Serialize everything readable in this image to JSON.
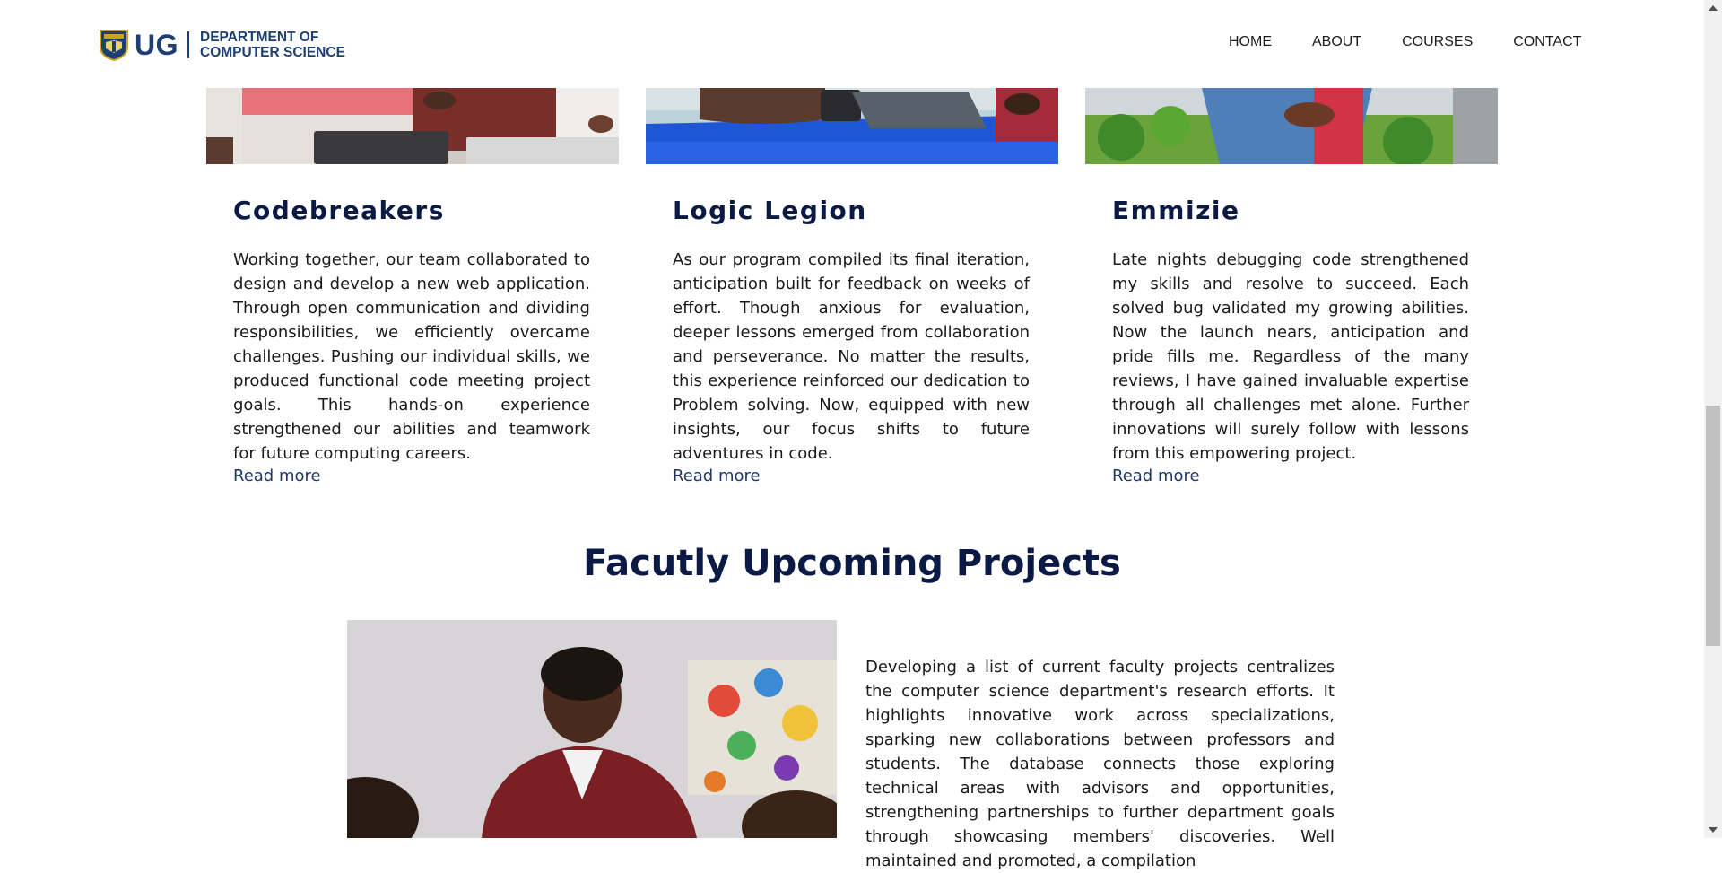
{
  "header": {
    "logo_ug": "UG",
    "logo_line1": "DEPARTMENT OF",
    "logo_line2": "COMPUTER SCIENCE",
    "nav": [
      "HOME",
      "ABOUT",
      "COURSES",
      "CONTACT"
    ]
  },
  "cards": [
    {
      "title": "Codebreakers",
      "text": "Working together, our team collaborated to design and develop a new web application. Through open communication and dividing responsibilities, we efficiently overcame challenges. Pushing our individual skills, we produced functional code meeting project goals. This hands-on experience strengthened our abilities and teamwork for future computing careers.",
      "link": "Read more"
    },
    {
      "title": "Logic Legion",
      "text": "As our program compiled its final iteration, anticipation built for feedback on weeks of effort. Though anxious for evaluation, deeper lessons emerged from collaboration and perseverance. No matter the results, this experience reinforced our dedication to Problem solving. Now, equipped with new insights, our focus shifts to future adventures in code.",
      "link": "Read more"
    },
    {
      "title": "Emmizie",
      "text": "Late nights debugging code strengthened my skills and resolve to succeed. Each solved bug validated my growing abilities. Now the launch nears, anticipation and pride fills me. Regardless of the many reviews, I have gained invaluable expertise through all challenges met alone. Further innovations will surely follow with lessons from this empowering project.",
      "link": "Read more"
    }
  ],
  "faculty": {
    "title": "Facutly Upcoming Projects",
    "text": "Developing a list of current faculty projects centralizes the computer science department's research efforts. It highlights innovative work across specializations, sparking new collaborations between professors and students. The database connects those exploring technical areas with advisors and opportunities, strengthening partnerships to further department goals through showcasing members' discoveries. Well maintained and promoted, a compilation"
  },
  "colors": {
    "brand_navy": "#1d3f73",
    "heading_navy": "#0b1a45",
    "link_blue": "#1f3766"
  }
}
